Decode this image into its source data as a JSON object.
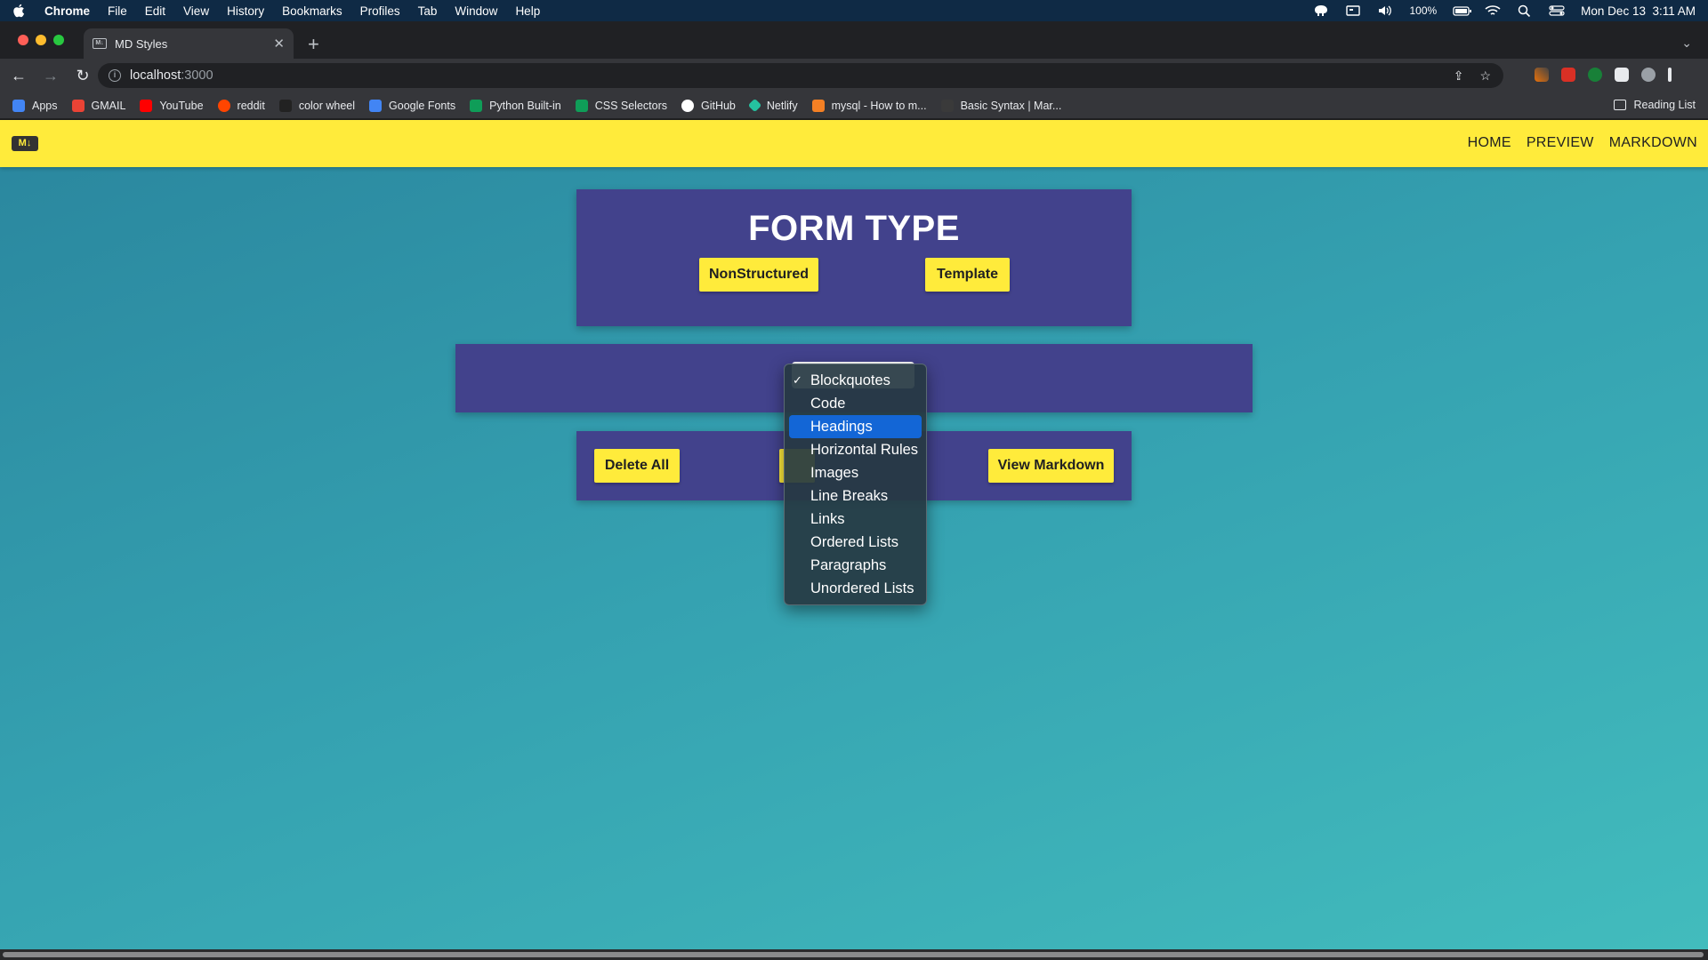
{
  "menubar": {
    "app_name": "Chrome",
    "menus": [
      "File",
      "Edit",
      "View",
      "History",
      "Bookmarks",
      "Profiles",
      "Tab",
      "Window",
      "Help"
    ],
    "battery": "100%",
    "datetime": "Mon Dec 13  3:11 AM"
  },
  "browser": {
    "tab_title": "MD Styles",
    "favicon_text": "M↓",
    "url_host": "localhost",
    "url_port": ":3000"
  },
  "bookmarks": [
    {
      "label": "Apps",
      "color": "#4285f4"
    },
    {
      "label": "GMAIL",
      "color": "#ea4335"
    },
    {
      "label": "YouTube",
      "color": "#ff0000"
    },
    {
      "label": "reddit",
      "color": "#ff4500"
    },
    {
      "label": "color wheel",
      "color": "#222222"
    },
    {
      "label": "Google Fonts",
      "color": "#4285f4"
    },
    {
      "label": "Python Built-in",
      "color": "#0f9d58"
    },
    {
      "label": "CSS Selectors",
      "color": "#0f9d58"
    },
    {
      "label": "GitHub",
      "color": "#ffffff"
    },
    {
      "label": "Netlify",
      "color": "#25c2a0"
    },
    {
      "label": "mysql - How to m...",
      "color": "#f48024"
    },
    {
      "label": "Basic Syntax | Mar...",
      "color": "#3a3a3a"
    }
  ],
  "reading_list": "Reading List",
  "navbar": {
    "brand": "M↓",
    "links": [
      "HOME",
      "PREVIEW",
      "MARKDOWN"
    ],
    "color": "#ffeb3b"
  },
  "form_card": {
    "title": "FORM TYPE",
    "buttons": [
      "NonStructured",
      "Template"
    ]
  },
  "actions": {
    "delete_all": "Delete All",
    "view_markdown": "View Markdown"
  },
  "dropdown": {
    "selected": "Blockquotes",
    "highlighted": "Headings",
    "options": [
      "Blockquotes",
      "Code",
      "Headings",
      "Horizontal Rules",
      "Images",
      "Line Breaks",
      "Links",
      "Ordered Lists",
      "Paragraphs",
      "Unordered Lists"
    ]
  }
}
